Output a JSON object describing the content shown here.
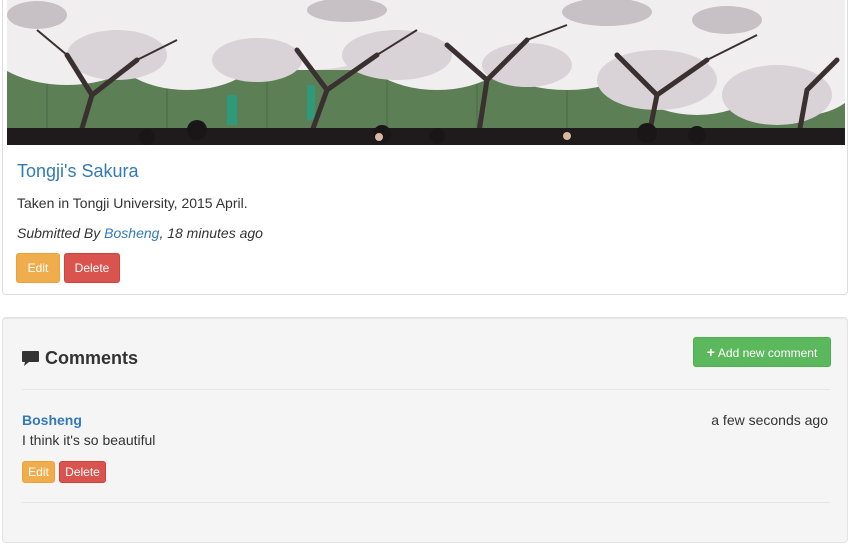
{
  "photo": {
    "title": "Tongji's Sakura",
    "description": "Taken in Tongji University, 2015 April.",
    "submitted_prefix": "Submitted By ",
    "author": "Bosheng",
    "time_suffix": ", 18 minutes ago",
    "edit_label": "Edit",
    "delete_label": "Delete",
    "image_subject": "cherry blossom trees"
  },
  "comments": {
    "heading": "Comments",
    "heading_icon": "comment-icon",
    "add_label": "Add new comment",
    "add_icon": "plus-icon",
    "items": [
      {
        "author": "Bosheng",
        "time": "a few seconds ago",
        "text": "I think it's so beautiful",
        "edit_label": "Edit",
        "delete_label": "Delete"
      }
    ]
  },
  "colors": {
    "link": "#337ab7",
    "warning": "#f0ad4e",
    "danger": "#d9534f",
    "success": "#5cb85c",
    "well_bg": "#f5f5f5"
  }
}
